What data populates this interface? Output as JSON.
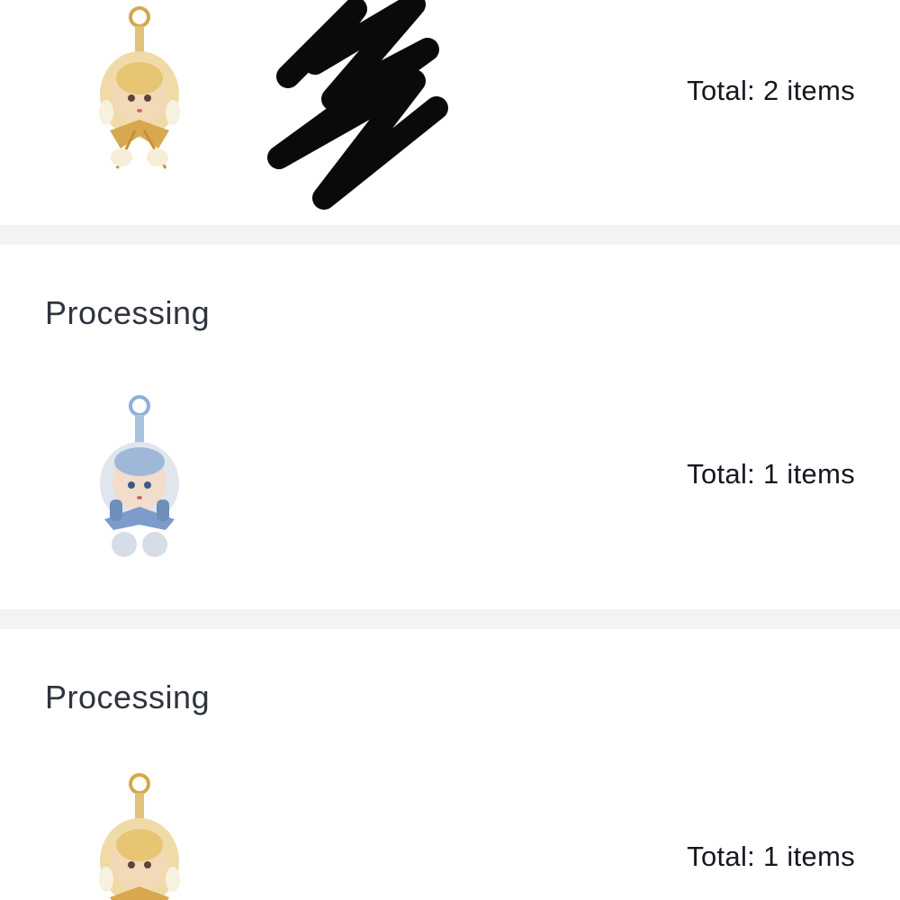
{
  "orders": [
    {
      "status": "",
      "total": "Total: 2 items",
      "product": {
        "variant": "gold-doll-keychain"
      },
      "redacted": true
    },
    {
      "status": "Processing",
      "total": "Total: 1 items",
      "product": {
        "variant": "blue-doll-keychain"
      }
    },
    {
      "status": "Processing",
      "total": "Total: 1 items",
      "product": {
        "variant": "gold-doll-keychain"
      }
    }
  ],
  "colors": {
    "divider": "#f3f3f3",
    "status_text": "#2f3440",
    "total_text": "#151820",
    "redaction": "#0a0a0a"
  }
}
